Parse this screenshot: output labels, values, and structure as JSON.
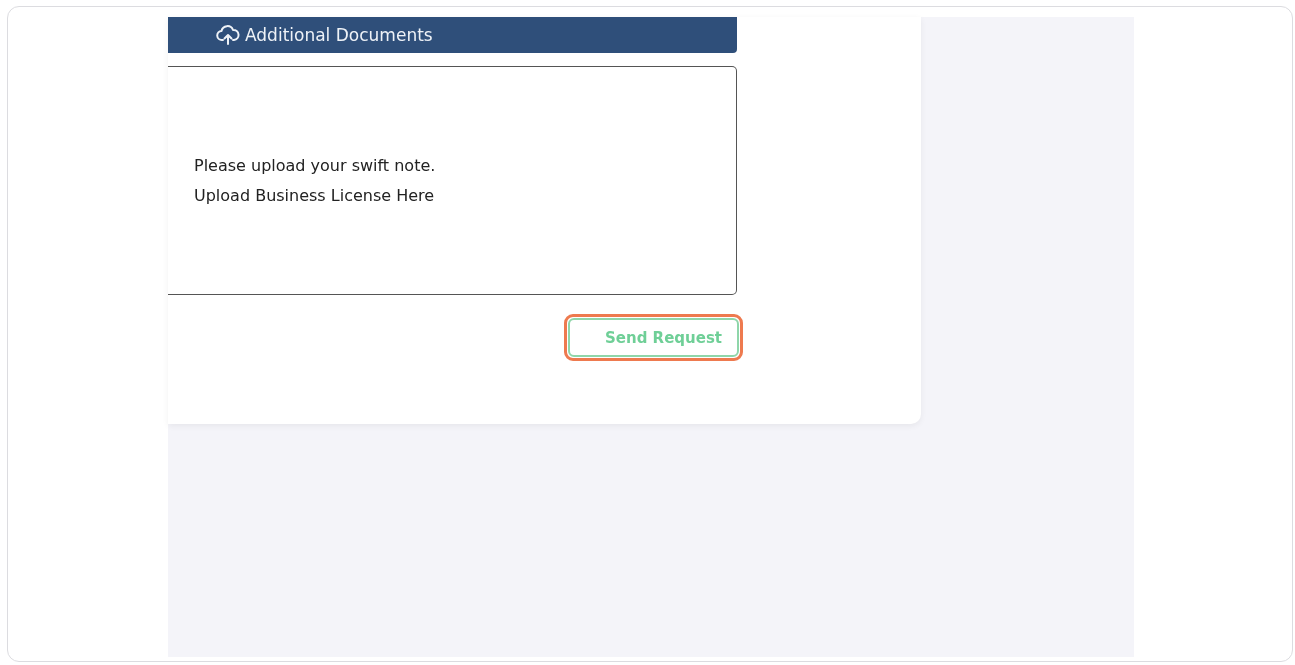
{
  "section_header": {
    "label": "Additional Documents"
  },
  "upload_box": {
    "lines": [
      "Please upload your swift note.",
      "Upload Business License Here"
    ]
  },
  "send_button": {
    "label": "Send Request",
    "highlighted": true
  }
}
